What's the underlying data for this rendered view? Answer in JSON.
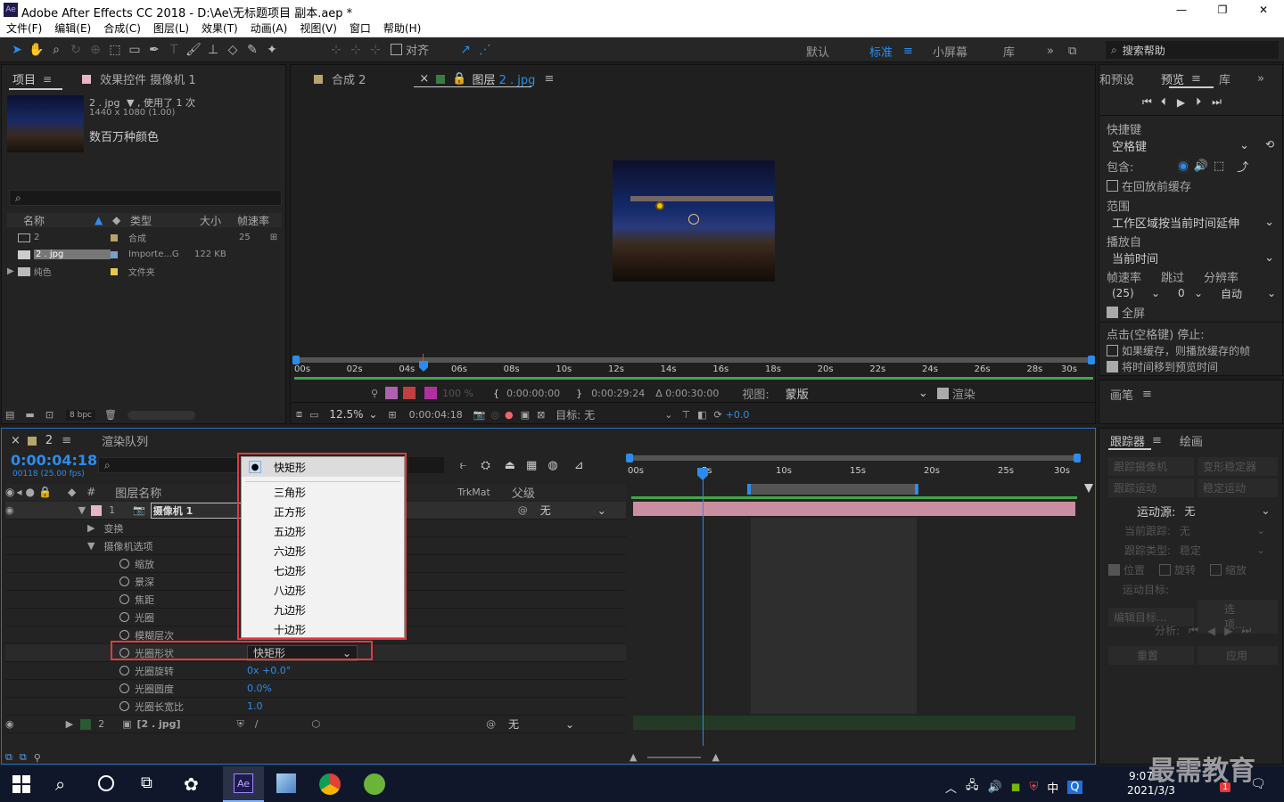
{
  "window": {
    "title": "Adobe After Effects CC 2018 - D:\\Ae\\无标题项目 副本.aep *",
    "app_icon": "Ae",
    "controls": [
      "—",
      "❐",
      "✕"
    ]
  },
  "menu": [
    "文件(F)",
    "编辑(E)",
    "合成(C)",
    "图层(L)",
    "效果(T)",
    "动画(A)",
    "视图(V)",
    "窗口",
    "帮助(H)"
  ],
  "toolbar": {
    "snap_label": "对齐",
    "workspaces": [
      "默认",
      "标准",
      "小屏幕",
      "库"
    ],
    "search_placeholder": "搜索帮助"
  },
  "project": {
    "tab_project": "项目",
    "tab_effects": "效果控件 摄像机 1",
    "item_name": "2 . jpg",
    "usage": "▼ , 使用了 1 次",
    "dims": "1440 x 1080 (1.00)",
    "color_desc": "数百万种颜色",
    "headers": [
      "名称",
      "类型",
      "大小",
      "帧速率"
    ],
    "rows": [
      {
        "name": "2",
        "type": "合成",
        "size": "",
        "fps": "25"
      },
      {
        "name": "2 . jpg",
        "type": "Importe...G",
        "size": "122 KB",
        "fps": ""
      },
      {
        "name": "纯色",
        "type": "文件夹",
        "size": "",
        "fps": ""
      }
    ],
    "bpc": "8 bpc"
  },
  "comp": {
    "tab1": "合成 2",
    "tab2": "图层 2 . jpg",
    "ruler": [
      "00s",
      "02s",
      "04s",
      "06s",
      "08s",
      "10s",
      "12s",
      "14s",
      "16s",
      "18s",
      "20s",
      "22s",
      "24s",
      "26s",
      "28s",
      "30s"
    ],
    "time_start": "0:00:00:00",
    "time_end": "0:00:29:24",
    "duration": "Δ 0:00:30:00",
    "view_label": "视图:",
    "view_value": "蒙版",
    "render_label": "渲染",
    "zoom": "12.5%",
    "current_time": "0:00:04:18",
    "target": "目标: 无",
    "exposure": "+0.0",
    "opacity": "100 %"
  },
  "preview": {
    "tabs": [
      "和预设",
      "预览",
      "库"
    ],
    "shortcut_label": "快捷键",
    "shortcut_value": "空格键",
    "include_label": "包含:",
    "cache_before": "在回放前缓存",
    "range_label": "范围",
    "range_value": "工作区域按当前时间延伸",
    "play_from_label": "播放自",
    "play_from_value": "当前时间",
    "fps_label": "帧速率",
    "skip_label": "跳过",
    "res_label": "分辨率",
    "fps_value": "(25)",
    "skip_value": "0",
    "res_value": "自动",
    "fullscreen": "全屏",
    "stop_label": "点击(空格键) 停止:",
    "if_cache": "如果缓存，则播放缓存的帧",
    "move_time": "将时间移到预览时间"
  },
  "brush": {
    "title": "画笔"
  },
  "tracker": {
    "tabs": [
      "跟踪器",
      "绘画"
    ],
    "btn_camera": "跟踪摄像机",
    "btn_warp": "变形稳定器",
    "btn_motion": "跟踪运动",
    "btn_stab": "稳定运动",
    "source_label": "运动源:",
    "source_value": "无",
    "current_label": "当前跟踪:",
    "current_value": "无",
    "type_label": "跟踪类型:",
    "type_value": "稳定",
    "pos": "位置",
    "rot": "旋转",
    "scale": "缩放",
    "target_label": "运动目标:",
    "edit_target": "编辑目标...",
    "options": "选项...",
    "analyze": "分析:",
    "reset": "重置",
    "apply": "应用"
  },
  "timeline": {
    "tab": "2",
    "tab_render": "渲染队列",
    "time": "0:00:04:18",
    "frames": "00118 (25.00 fps)",
    "col_name": "图层名称",
    "col_trkmat": "TrkMat",
    "col_parent": "父级",
    "layer1": {
      "num": "1",
      "name": "摄像机 1",
      "parent": "无"
    },
    "layer2": {
      "num": "2",
      "name": "[2 . jpg]",
      "parent": "无"
    },
    "props": [
      "变换",
      "摄像机选项",
      "缩放",
      "景深",
      "焦距",
      "光圈",
      "模糊层次",
      "光圈形状",
      "光圈旋转",
      "光圈圆度",
      "光圈长宽比"
    ],
    "aperture_value": "快矩形",
    "rotation_value": "0x +0.0°",
    "roundness_value": "0.0%",
    "aspect_value": "1.0",
    "ruler": [
      "00s",
      "5s",
      "10s",
      "15s",
      "20s",
      "25s",
      "30s"
    ]
  },
  "dropdown": {
    "items": [
      "快矩形",
      "三角形",
      "正方形",
      "五边形",
      "六边形",
      "七边形",
      "八边形",
      "九边形",
      "十边形"
    ],
    "selected": "快矩形"
  },
  "taskbar": {
    "time": "9:07",
    "date": "2021/3/3",
    "ime": "中",
    "watermark": "最需教育",
    "badge": "1"
  },
  "colors": {
    "accent": "#2d8ceb",
    "highlight": "#e23b3b",
    "camera_bar": "#c98ea0",
    "green": "#3fa64b"
  }
}
